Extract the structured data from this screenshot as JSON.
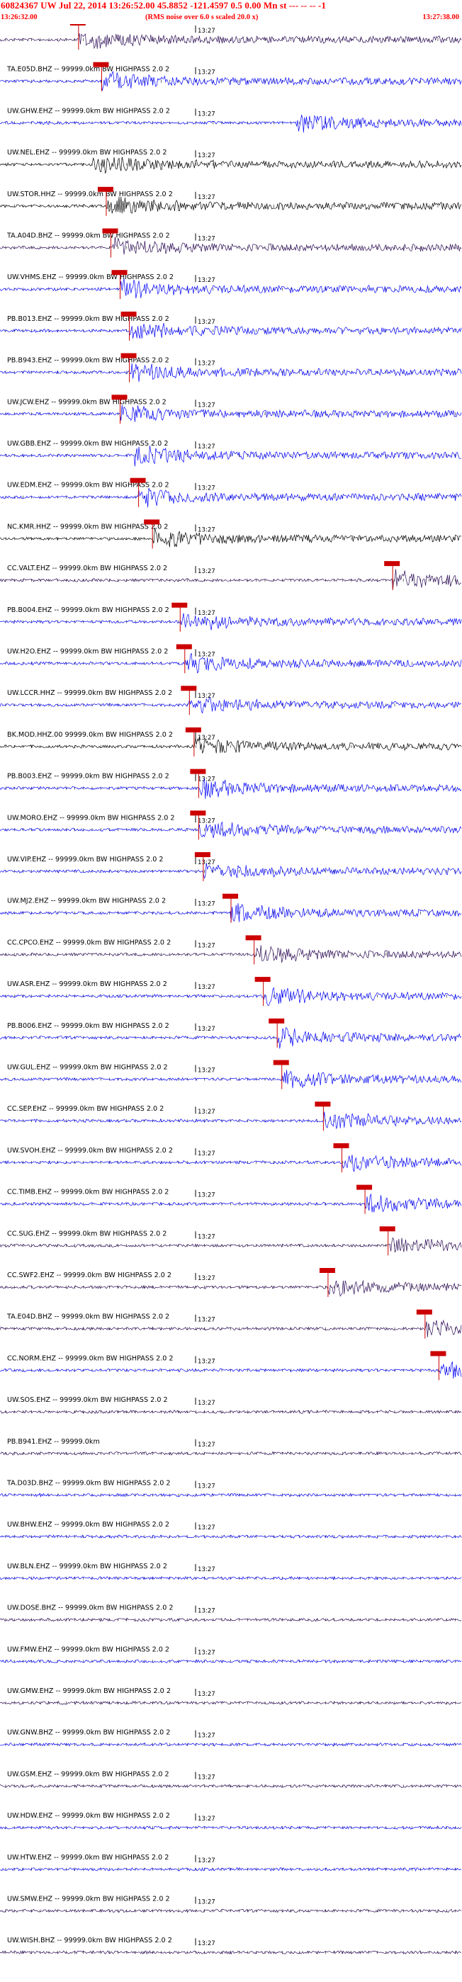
{
  "header": {
    "title": "60824367 UW Jul 22, 2014 13:26:52.00    45.8852  -121.4597   0.5 0.00 Mn st --- --  --   -1",
    "start_time": "13:26:32.00",
    "end_time": "13:27:38.00",
    "note": "(RMS noise over 6.0 s scaled 20.0 x)"
  },
  "tick_label": "13:27",
  "colors": {
    "header_red": "#ff0000",
    "trace_blue": "#0000ff",
    "trace_purple": "#2a0a55",
    "trace_black": "#000000",
    "pick_red": "#cc0000"
  },
  "channels": [
    {
      "label": "",
      "color": "purple",
      "pick": "p",
      "onset": 0.17
    },
    {
      "label": "TA.E05D.BHZ -- 99999.0km BW  HIGHPASS  2.0 2",
      "color": "blue",
      "pick": "p",
      "onset": 0.22
    },
    {
      "label": "UW.GHW.EHZ -- 99999.0km BW  HIGHPASS  2.0 2",
      "color": "blue",
      "pick": "",
      "onset": 0.64
    },
    {
      "label": "UW.NEL.EHZ -- 99999.0km BW  HIGHPASS  2.0 2",
      "color": "black",
      "pick": "",
      "onset": 0.2
    },
    {
      "label": "UW.STOR.HHZ -- 99999.0km BW  HIGHPASS  2.0 2",
      "color": "black",
      "pick": "p",
      "onset": 0.23
    },
    {
      "label": "TA.A04D.BHZ -- 99999.0km BW  HIGHPASS  2.0 2",
      "color": "purple",
      "pick": "p",
      "onset": 0.24
    },
    {
      "label": "UW.VHMS.EHZ -- 99999.0km BW  HIGHPASS  2.0 2",
      "color": "blue",
      "pick": "p",
      "onset": 0.26
    },
    {
      "label": "PB.B013.EHZ -- 99999.0km BW  HIGHPASS  2.0 2",
      "color": "blue",
      "pick": "p",
      "onset": 0.28
    },
    {
      "label": "PB.B943.EHZ -- 99999.0km BW  HIGHPASS  2.0 2",
      "color": "blue",
      "pick": "p",
      "onset": 0.28
    },
    {
      "label": "UW.JCW.EHZ -- 99999.0km BW  HIGHPASS  2.0 2",
      "color": "blue",
      "pick": "p",
      "onset": 0.26
    },
    {
      "label": "UW.GBB.EHZ -- 99999.0km BW  HIGHPASS  2.0 2",
      "color": "blue",
      "pick": "",
      "onset": 0.29
    },
    {
      "label": "UW.EDM.EHZ -- 99999.0km BW  HIGHPASS  2.0 2",
      "color": "blue",
      "pick": "p",
      "onset": 0.3
    },
    {
      "label": "NC.KMR.HHZ -- 99999.0km BW  HIGHPASS  2.0 2",
      "color": "black",
      "pick": "p",
      "onset": 0.33
    },
    {
      "label": "CC.VALT.EHZ -- 99999.0km BW  HIGHPASS  2.0 2",
      "color": "purple",
      "pick": "s",
      "onset": 0.85
    },
    {
      "label": "PB.B004.EHZ -- 99999.0km BW  HIGHPASS  2.0 2",
      "color": "blue",
      "pick": "p",
      "onset": 0.39
    },
    {
      "label": "UW.H2O.EHZ -- 99999.0km BW  HIGHPASS  2.0 2",
      "color": "blue",
      "pick": "p",
      "onset": 0.4
    },
    {
      "label": "UW.LCCR.HHZ -- 99999.0km BW  HIGHPASS  2.0 2",
      "color": "blue",
      "pick": "p",
      "onset": 0.41
    },
    {
      "label": "BK.MOD.HHZ.00 99999.0km BW  HIGHPASS  2.0 2",
      "color": "black",
      "pick": "p",
      "onset": 0.42
    },
    {
      "label": "PB.B003.EHZ -- 99999.0km BW  HIGHPASS  2.0 2",
      "color": "blue",
      "pick": "p",
      "onset": 0.43
    },
    {
      "label": "UW.MORO.EHZ -- 99999.0km BW  HIGHPASS  2.0 2",
      "color": "blue",
      "pick": "p",
      "onset": 0.43
    },
    {
      "label": "UW.VIP.EHZ -- 99999.0km BW  HIGHPASS  2.0 2",
      "color": "blue",
      "pick": "p",
      "onset": 0.44
    },
    {
      "label": "UW.MJ2.EHZ -- 99999.0km BW  HIGHPASS  2.0 2",
      "color": "blue",
      "pick": "p",
      "onset": 0.5
    },
    {
      "label": "CC.CPCO.EHZ -- 99999.0km BW  HIGHPASS  2.0 2",
      "color": "purple",
      "pick": "p",
      "onset": 0.55
    },
    {
      "label": "UW.ASR.EHZ -- 99999.0km BW  HIGHPASS  2.0 2",
      "color": "blue",
      "pick": "p",
      "onset": 0.57
    },
    {
      "label": "PB.B006.EHZ -- 99999.0km BW  HIGHPASS  2.0 2",
      "color": "blue",
      "pick": "p",
      "onset": 0.6
    },
    {
      "label": "UW.GUL.EHZ -- 99999.0km BW  HIGHPASS  2.0 2",
      "color": "blue",
      "pick": "p",
      "onset": 0.61
    },
    {
      "label": "CC.SEP.EHZ -- 99999.0km BW  HIGHPASS  2.0 2",
      "color": "blue",
      "pick": "p",
      "onset": 0.7
    },
    {
      "label": "UW.SVOH.EHZ -- 99999.0km BW  HIGHPASS  2.0 2",
      "color": "blue",
      "pick": "p",
      "onset": 0.74
    },
    {
      "label": "CC.TIMB.EHZ -- 99999.0km BW  HIGHPASS  2.0 2",
      "color": "blue",
      "pick": "p",
      "onset": 0.79
    },
    {
      "label": "CC.SUG.EHZ -- 99999.0km BW  HIGHPASS  2.0 2",
      "color": "purple",
      "pick": "p",
      "onset": 0.84
    },
    {
      "label": "CC.SWF2.EHZ -- 99999.0km BW  HIGHPASS  2.0 2",
      "color": "purple",
      "pick": "p",
      "onset": 0.71
    },
    {
      "label": "TA.E04D.BHZ -- 99999.0km BW  HIGHPASS  2.0 2",
      "color": "purple",
      "pick": "p",
      "onset": 0.92
    },
    {
      "label": "CC.NORM.EHZ -- 99999.0km BW  HIGHPASS  2.0 2",
      "color": "blue",
      "pick": "p",
      "onset": 0.95
    },
    {
      "label": "UW.SOS.EHZ -- 99999.0km BW  HIGHPASS  2.0 2",
      "color": "purple",
      "pick": "",
      "onset": -1
    },
    {
      "label": "PB.B941.EHZ -- 99999.0km",
      "color": "purple",
      "pick": "",
      "onset": -1
    },
    {
      "label": "TA.D03D.BHZ -- 99999.0km BW  HIGHPASS  2.0 2",
      "color": "blue",
      "pick": "",
      "onset": -1
    },
    {
      "label": "UW.BHW.EHZ -- 99999.0km BW  HIGHPASS  2.0 2",
      "color": "blue",
      "pick": "",
      "onset": -1
    },
    {
      "label": "UW.BLN.EHZ -- 99999.0km BW  HIGHPASS  2.0 2",
      "color": "blue",
      "pick": "",
      "onset": -1
    },
    {
      "label": "UW.DOSE.BHZ -- 99999.0km BW  HIGHPASS  2.0 2",
      "color": "purple",
      "pick": "",
      "onset": -1
    },
    {
      "label": "UW.FMW.EHZ -- 99999.0km BW  HIGHPASS  2.0 2",
      "color": "blue",
      "pick": "",
      "onset": -1
    },
    {
      "label": "UW.GMW.EHZ -- 99999.0km BW  HIGHPASS  2.0 2",
      "color": "purple",
      "pick": "",
      "onset": -1
    },
    {
      "label": "UW.GNW.BHZ -- 99999.0km BW  HIGHPASS  2.0 2",
      "color": "blue",
      "pick": "",
      "onset": -1
    },
    {
      "label": "UW.GSM.EHZ -- 99999.0km BW  HIGHPASS  2.0 2",
      "color": "purple",
      "pick": "",
      "onset": -1
    },
    {
      "label": "UW.HDW.EHZ -- 99999.0km BW  HIGHPASS  2.0 2",
      "color": "blue",
      "pick": "",
      "onset": -1
    },
    {
      "label": "UW.HTW.EHZ -- 99999.0km BW  HIGHPASS  2.0 2",
      "color": "blue",
      "pick": "",
      "onset": -1
    },
    {
      "label": "UW.SMW.EHZ -- 99999.0km BW  HIGHPASS  2.0 2",
      "color": "purple",
      "pick": "",
      "onset": -1
    },
    {
      "label": "UW.WISH.BHZ -- 99999.0km BW  HIGHPASS  2.0 2",
      "color": "purple",
      "pick": "",
      "onset": -1
    }
  ]
}
